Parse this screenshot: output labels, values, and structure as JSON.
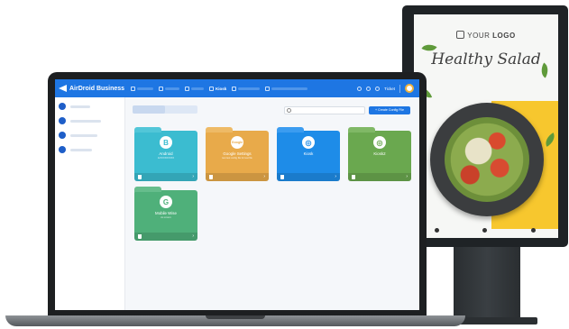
{
  "poster": {
    "logo_prefix": "YOUR ",
    "logo_bold": "LOGO",
    "title": "Healthy Salad"
  },
  "app": {
    "brand": "AirDroid Business",
    "nav_active_label": "Kiosk",
    "ticket_label": "Ticket"
  },
  "toolbar": {
    "create_label": "+ Create Config File",
    "search_placeholder": ""
  },
  "cards": [
    {
      "logo": "B",
      "name": "Android",
      "desc": "ArXXXXXXXXX",
      "color": "#3bbcd0",
      "tab": "#52c6d8"
    },
    {
      "logo": "Google",
      "name": "Google Settings",
      "desc": "test test config file for test file",
      "color": "#e8aa4a",
      "tab": "#eeba66"
    },
    {
      "logo": "◎",
      "name": "Kiosk",
      "desc": "",
      "color": "#1e8ce8",
      "tab": "#3b9cf0"
    },
    {
      "logo": "◎",
      "name": "Kiosk2",
      "desc": "",
      "color": "#6aa84f",
      "tab": "#80b866"
    },
    {
      "logo": "G",
      "name": "Mobile Wise",
      "desc": "Ax.xxxxxx",
      "color": "#4fb07a",
      "tab": "#66bd8c"
    }
  ],
  "colors": {
    "header_blue": "#1e76e3",
    "kiosk_yellow": "#f7c72e"
  }
}
